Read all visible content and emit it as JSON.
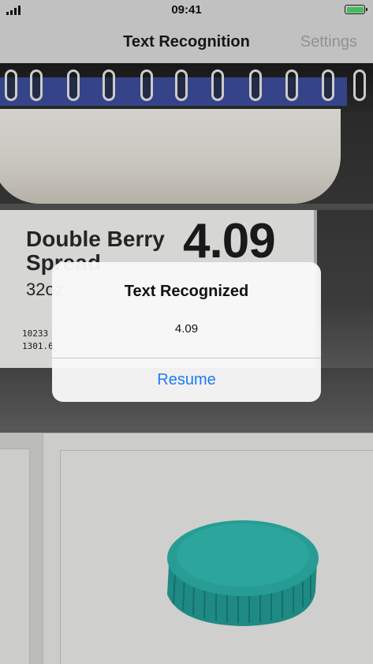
{
  "status_bar": {
    "time": "09:41",
    "battery_color": "#4cd964"
  },
  "nav": {
    "title": "Text Recognition",
    "settings_label": "Settings"
  },
  "camera_feed": {
    "price_label": {
      "product_line1": "Double Berry",
      "product_line2": "Spread",
      "price": "4.09",
      "size": "32oz",
      "code_line1": "10233",
      "code_line2": "1301.6"
    }
  },
  "alert": {
    "title": "Text Recognized",
    "message": "4.09",
    "button_label": "Resume",
    "button_color": "#1a7cf2"
  }
}
